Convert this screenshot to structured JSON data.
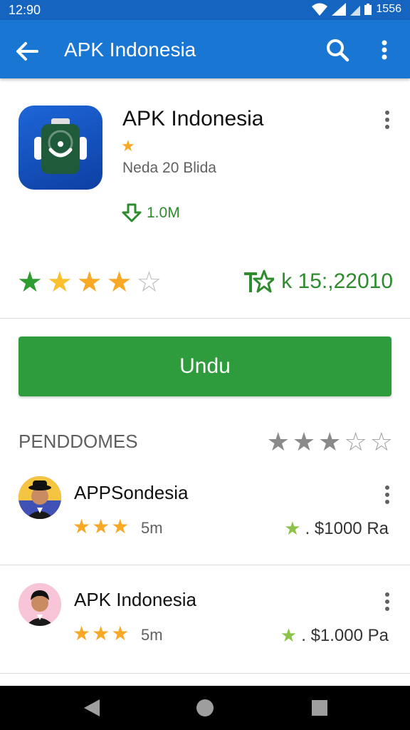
{
  "status_bar": {
    "time": "12:90",
    "battery_text": "1556"
  },
  "app_bar": {
    "title": "APK Indonesia"
  },
  "app": {
    "name": "APK Indonesia",
    "developer": "Neda 20 Blida",
    "downloads": "1.0M",
    "rating_stars": 4,
    "stat_text": "k 15:,22010"
  },
  "install_button": {
    "label": "Undu"
  },
  "reviews_section": {
    "title": "PENDDOMES",
    "stars": 3
  },
  "reviews": [
    {
      "name": "APPSondesia",
      "stars": 3,
      "meta": "5m",
      "price": ". $1000 Ra"
    },
    {
      "name": "APK Indonesia",
      "stars": 3,
      "meta": "5m",
      "price": ". $1.000 Pa"
    }
  ],
  "icons": {
    "back": "arrow-left-icon",
    "search": "search-icon",
    "more": "more-vert-icon",
    "download": "download-icon",
    "trophy": "star-trophy-icon"
  },
  "colors": {
    "app_bar": "#1976d2",
    "status_bar": "#1565c0",
    "install": "#2e9c3c",
    "accent_green": "#2e8b2e",
    "star": "#f9a825"
  }
}
